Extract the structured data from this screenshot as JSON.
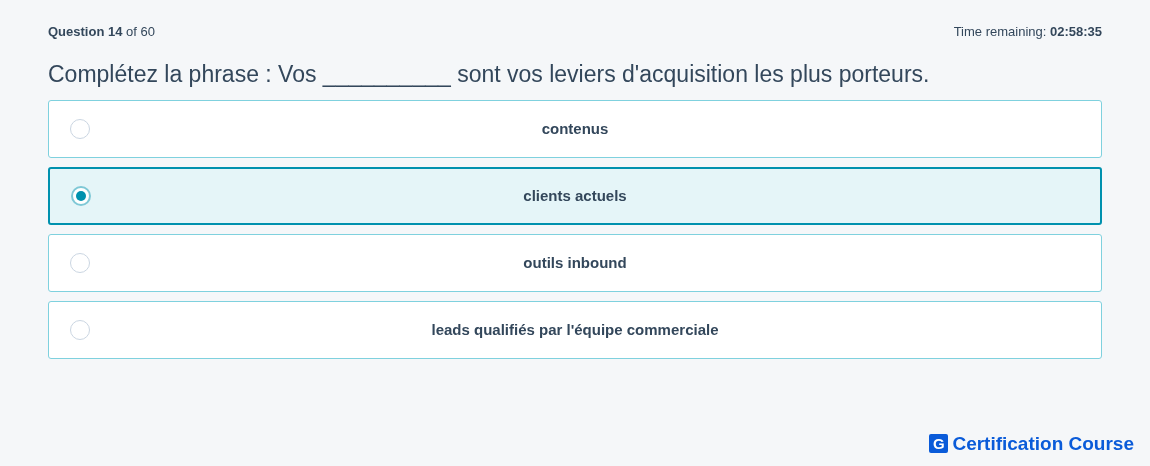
{
  "header": {
    "progress": "**Question 14** of 60",
    "timer": "Time remaining: **02:58:35**"
  },
  "question": "Complétez la phrase : Vos __________ sont vos leviers d'acquisition les plus porteurs.",
  "options": [
    {
      "label": "contenus",
      "selected": false
    },
    {
      "label": "clients actuels",
      "selected": true
    },
    {
      "label": "outils inbound",
      "selected": false
    },
    {
      "label": "leads qualifiés par l'équipe commerciale",
      "selected": false
    }
  ],
  "brand": {
    "logo_letter": "G",
    "name": "Certification Course"
  }
}
